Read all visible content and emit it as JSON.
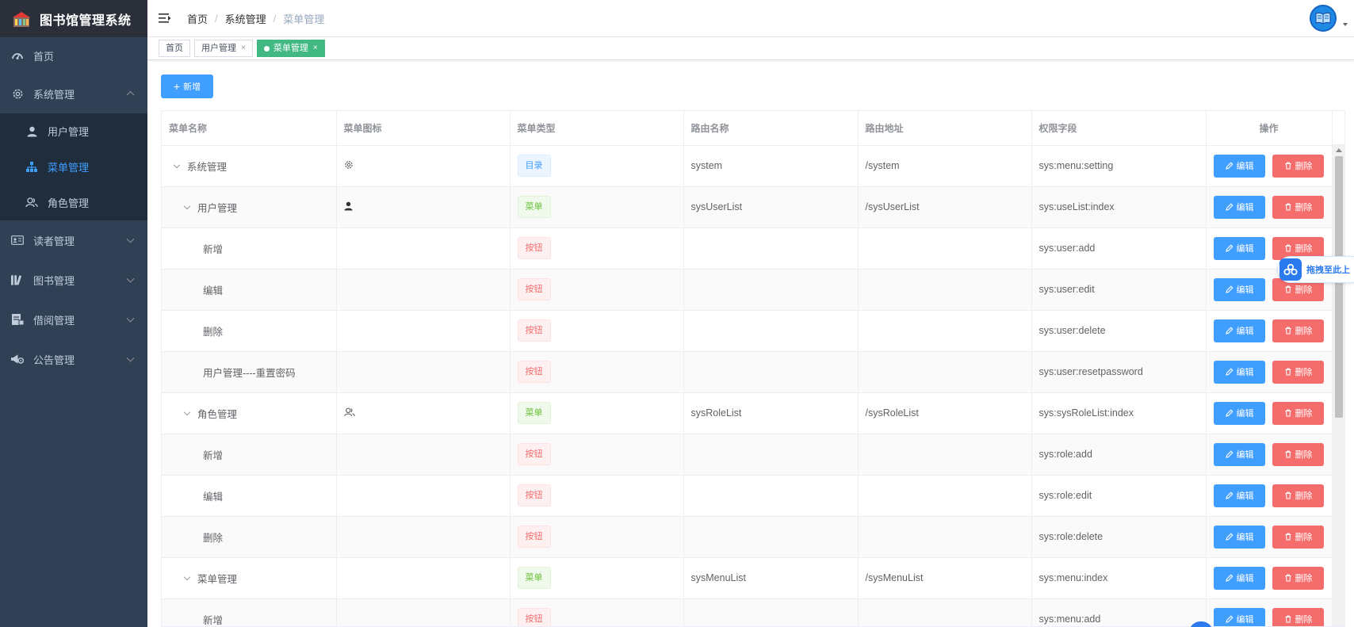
{
  "app": {
    "title": "图书馆管理系统"
  },
  "sidebar": {
    "home": "首页",
    "system": {
      "label": "系统管理",
      "children": [
        "用户管理",
        "菜单管理",
        "角色管理"
      ]
    },
    "reader": "读者管理",
    "book": "图书管理",
    "borrow": "借阅管理",
    "notice": "公告管理"
  },
  "breadcrumb": [
    "首页",
    "系统管理",
    "菜单管理"
  ],
  "tags": [
    {
      "label": "首页"
    },
    {
      "label": "用户管理",
      "close": "×"
    },
    {
      "label": "菜单管理",
      "close": "×"
    }
  ],
  "toolbar": {
    "add_label": "新增",
    "add_plus": "+"
  },
  "table": {
    "headers": [
      "菜单名称",
      "菜单图标",
      "菜单类型",
      "路由名称",
      "路由地址",
      "权限字段",
      "操作"
    ],
    "edit_label": "编辑",
    "delete_label": "删除",
    "rows": [
      {
        "name": "系统管理",
        "icon": "gear-icon",
        "type": "目录",
        "route_name": "system",
        "route_path": "/system",
        "perm": "sys:menu:setting"
      },
      {
        "name": "用户管理",
        "icon": "user-icon",
        "type": "菜单",
        "route_name": "sysUserList",
        "route_path": "/sysUserList",
        "perm": "sys:useList:index"
      },
      {
        "name": "新增",
        "icon": "",
        "type": "按钮",
        "route_name": "",
        "route_path": "",
        "perm": "sys:user:add"
      },
      {
        "name": "编辑",
        "icon": "",
        "type": "按钮",
        "route_name": "",
        "route_path": "",
        "perm": "sys:user:edit"
      },
      {
        "name": "删除",
        "icon": "",
        "type": "按钮",
        "route_name": "",
        "route_path": "",
        "perm": "sys:user:delete"
      },
      {
        "name": "用户管理----重置密码",
        "icon": "",
        "type": "按钮",
        "route_name": "",
        "route_path": "",
        "perm": "sys:user:resetpassword"
      },
      {
        "name": "角色管理",
        "icon": "users-icon",
        "type": "菜单",
        "route_name": "sysRoleList",
        "route_path": "/sysRoleList",
        "perm": "sys:sysRoleList:index"
      },
      {
        "name": "新增",
        "icon": "",
        "type": "按钮",
        "route_name": "",
        "route_path": "",
        "perm": "sys:role:add"
      },
      {
        "name": "编辑",
        "icon": "",
        "type": "按钮",
        "route_name": "",
        "route_path": "",
        "perm": "sys:role:edit"
      },
      {
        "name": "删除",
        "icon": "",
        "type": "按钮",
        "route_name": "",
        "route_path": "",
        "perm": "sys:role:delete"
      },
      {
        "name": "菜单管理",
        "icon": "",
        "type": "菜单",
        "route_name": "sysMenuList",
        "route_path": "/sysMenuList",
        "perm": "sys:menu:index"
      },
      {
        "name": "新增",
        "icon": "",
        "type": "按钮",
        "route_name": "",
        "route_path": "",
        "perm": "sys:menu:add"
      }
    ]
  },
  "float_widget": {
    "label": "拖拽至此上"
  },
  "colors": {
    "primary": "#409eff",
    "danger": "#f56c6c",
    "success": "#67c23a",
    "sidebar": "#304156",
    "tag_active": "#42b983"
  }
}
